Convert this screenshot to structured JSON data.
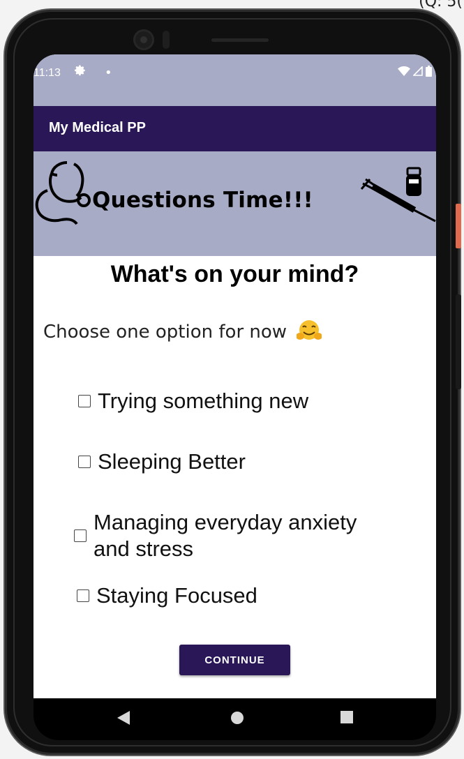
{
  "status_bar": {
    "time": "11:13",
    "gear_icon": "gear-icon",
    "notification_dot": "•"
  },
  "app_bar": {
    "title": "My Medical PP"
  },
  "banner": {
    "title": "Questions Time!!!",
    "left_icon": "stethoscope-icon",
    "right_icon": "syringe-vial-icon"
  },
  "main": {
    "headline": "What's on your mind?",
    "subline": "Choose one option for now",
    "subline_icon": "hugging-face-emoji-icon",
    "options": [
      {
        "label": "Trying something new",
        "checked": false
      },
      {
        "label": "Sleeping Better",
        "checked": false
      },
      {
        "label": "Managing everyday anxiety and stress",
        "checked": false
      },
      {
        "label": "Staying Focused",
        "checked": false
      }
    ],
    "continue_label": "CONTINUE"
  },
  "nav_bar": {
    "back_icon": "back-triangle-icon",
    "home_icon": "home-circle-icon",
    "recent_icon": "recent-square-icon"
  },
  "colors": {
    "primary": "#2a1758",
    "status_and_banner": "#a7abc6",
    "background": "#ffffff"
  }
}
